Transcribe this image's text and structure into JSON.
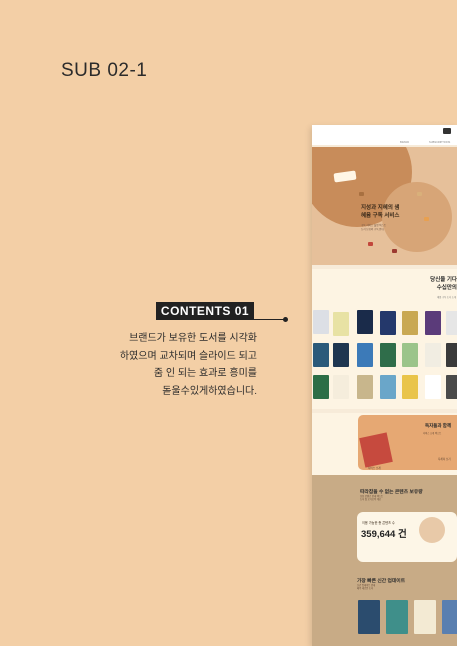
{
  "heading": {
    "title": "SUB 02-1"
  },
  "contents": {
    "badge": "CONTENTS 01",
    "lines": [
      "브랜드가 보유한 도서를 시각화",
      "하였으며 교차되며 슬라이드 되고",
      "줌 인 되는 효과로 흥미를",
      "돋울수있게하였습니다."
    ]
  },
  "mockup": {
    "menu": [
      "BRAND",
      "SUBSCRIPTIONS"
    ],
    "hero": {
      "title_lines": [
        "지성과 지혜의 샘",
        "혜윰 구독 서비스"
      ],
      "small_lines": [
        "구독 서비스 설명 텍스트",
        "도서 보유와 구독 안내"
      ]
    },
    "books": {
      "title_lines": [
        "당신을 기다",
        "수십만의"
      ],
      "small": "혜윰 구독 도서 소개"
    },
    "reader": {
      "title": "독자들과 함께",
      "small": "서비스 소개 텍스트",
      "button": "자세히 보기",
      "caption": "서비스 소개"
    },
    "content_count": {
      "title": "따라잡을 수 없는 콘텐츠 보유량",
      "small_lines": [
        "보유 콘텐츠 안내 텍스트",
        "도서 및 오디오북 제공"
      ],
      "label": "이용 가능한 총 콘텐츠 수",
      "count": "359,644 건"
    },
    "update": {
      "title": "가장 빠른 신간 업데이트",
      "small_lines": [
        "신간 업데이트 안내",
        "매주 새로운 도서"
      ]
    }
  },
  "colors": {
    "background": "#f3cfa6",
    "badge": "#222222",
    "accent": "#c88c5a"
  }
}
